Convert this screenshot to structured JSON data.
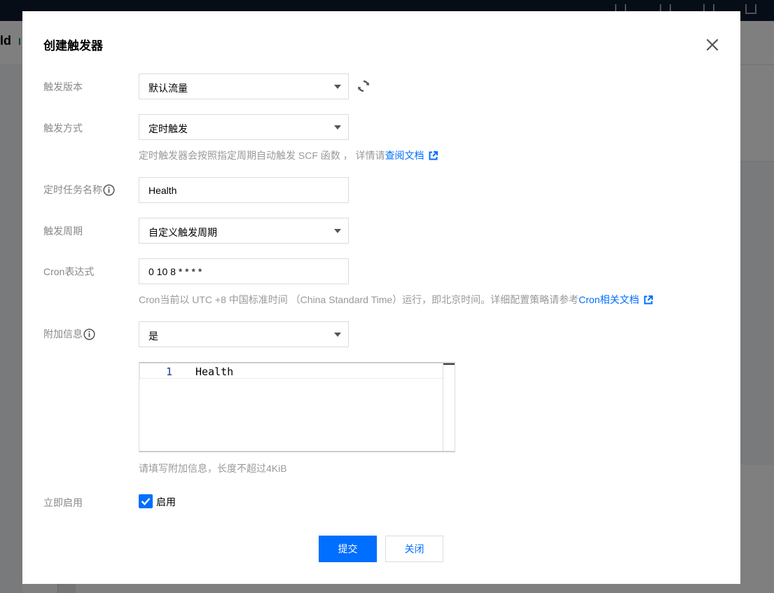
{
  "background": {
    "page_title_prefix": "ld",
    "page_title_suffix": "I"
  },
  "dialog": {
    "title": "创建触发器",
    "close_icon": "close-icon"
  },
  "form": {
    "version": {
      "label": "触发版本",
      "value": "默认流量"
    },
    "method": {
      "label": "触发方式",
      "value": "定时触发",
      "hint": "定时触发器会按照指定周期自动触发 SCF 函数 ， 详情请",
      "hint_link": "查阅文档"
    },
    "task_name": {
      "label": "定时任务名称",
      "value": "Health"
    },
    "period": {
      "label": "触发周期",
      "value": "自定义触发周期"
    },
    "cron": {
      "label": "Cron表达式",
      "value": "0 10 8 * * * *",
      "hint": "Cron当前以 UTC +8 中国标准时间 （China Standard Time）运行，即北京时间。详细配置策略请参考",
      "hint_link": "Cron相关文档"
    },
    "extra_info": {
      "label": "附加信息",
      "value": "是",
      "editor_line_number": "1",
      "editor_content": "Health",
      "hint": "请填写附加信息，长度不超过4KiB"
    },
    "enable": {
      "label": "立即启用",
      "checkbox_label": "启用",
      "checked": true
    }
  },
  "buttons": {
    "submit": "提交",
    "close": "关闭"
  },
  "colors": {
    "primary": "#006eff",
    "label": "#888888",
    "hint": "#999999"
  }
}
